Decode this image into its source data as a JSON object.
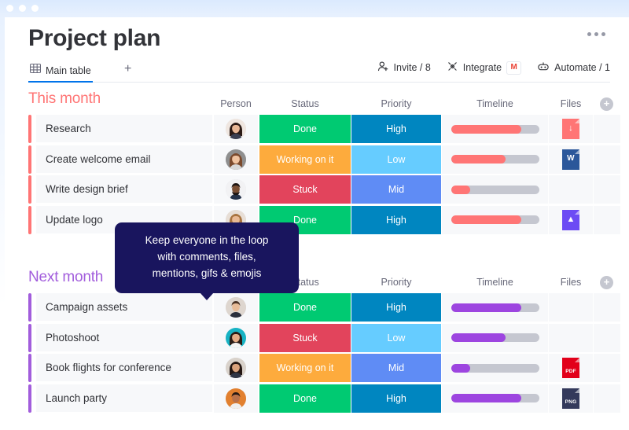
{
  "window": {
    "dots": 3
  },
  "header": {
    "title": "Project plan",
    "menu_icon": "ellipsis-icon"
  },
  "tabs": {
    "main_tab_label": "Main table",
    "main_tab_icon": "table-grid-icon",
    "add_tab_label": "+",
    "underline_color": "#0073ea"
  },
  "toolbar": {
    "items": [
      {
        "label": "Invite / 8",
        "icon": "person-add-icon"
      },
      {
        "label": "Integrate",
        "icon": "integrate-icon",
        "badge": "M",
        "badge_name": "gmail-icon"
      },
      {
        "label": "Automate / 1",
        "icon": "robot-icon"
      }
    ]
  },
  "columns": {
    "headers": [
      "Person",
      "Status",
      "Priority",
      "Timeline",
      "Files"
    ],
    "add_column_label": "+"
  },
  "colors": {
    "status_done": "#00ca72",
    "status_working": "#fdab3d",
    "status_stuck": "#e2445c",
    "priority_high": "#0086c0",
    "priority_low": "#66ccff",
    "priority_mid": "#5f8cf5",
    "group_this_month": "#ff7575",
    "group_next_month": "#a25ddc",
    "tooltip_bg": "#19155e"
  },
  "groups": [
    {
      "title": "This month",
      "accent": "#ff7575",
      "timeline_fill": "#ff7575",
      "rows": [
        {
          "name": "Research",
          "avatar_name": "avatar-woman-dark-hair",
          "status": "Done",
          "status_color": "#00ca72",
          "priority": "High",
          "priority_color": "#0086c0",
          "progress": 80,
          "file": {
            "type": "audio",
            "label": "",
            "glyph": "↓",
            "color": "#ff7575"
          }
        },
        {
          "name": "Create welcome email",
          "avatar_name": "avatar-woman-brown-hair",
          "status": "Working on it",
          "status_color": "#fdab3d",
          "priority": "Low",
          "priority_color": "#66ccff",
          "progress": 62,
          "file": {
            "type": "word",
            "label": "",
            "glyph": "W",
            "color": "#2b579a"
          }
        },
        {
          "name": "Write design brief",
          "avatar_name": "avatar-man-beard",
          "status": "Stuck",
          "status_color": "#e2445c",
          "priority": "Mid",
          "priority_color": "#5f8cf5",
          "progress": 22,
          "file": null
        },
        {
          "name": "Update logo",
          "avatar_name": "avatar-woman-curly-hair",
          "status": "Done",
          "status_color": "#00ca72",
          "priority": "High",
          "priority_color": "#0086c0",
          "progress": 80,
          "file": {
            "type": "image",
            "label": "",
            "glyph": "▲",
            "color": "#6c4bf4"
          }
        }
      ]
    },
    {
      "title": "Next month",
      "accent": "#a25ddc",
      "timeline_fill": "#9d45e0",
      "rows": [
        {
          "name": "Campaign assets",
          "avatar_name": "avatar-man-suit",
          "status": "Done",
          "status_color": "#00ca72",
          "priority": "High",
          "priority_color": "#0086c0",
          "progress": 80,
          "file": null
        },
        {
          "name": "Photoshoot",
          "avatar_name": "avatar-woman-teal-bg",
          "status": "Stuck",
          "status_color": "#e2445c",
          "priority": "Low",
          "priority_color": "#66ccff",
          "progress": 62,
          "file": null
        },
        {
          "name": "Book flights for conference",
          "avatar_name": "avatar-woman-smiling",
          "status": "Working on it",
          "status_color": "#fdab3d",
          "priority": "Mid",
          "priority_color": "#5f8cf5",
          "progress": 22,
          "file": {
            "type": "pdf",
            "label": "PDF",
            "glyph": "",
            "color": "#e2001a"
          }
        },
        {
          "name": "Launch party",
          "avatar_name": "avatar-man-orange-bg",
          "status": "Done",
          "status_color": "#00ca72",
          "priority": "High",
          "priority_color": "#0086c0",
          "progress": 80,
          "file": {
            "type": "png",
            "label": "PNG",
            "glyph": "",
            "color": "#333churn"
          }
        }
      ]
    }
  ],
  "tooltip": {
    "line1": "Keep everyone in the loop",
    "line2": "with comments, files,",
    "line3": "mentions, gifs & emojis"
  }
}
